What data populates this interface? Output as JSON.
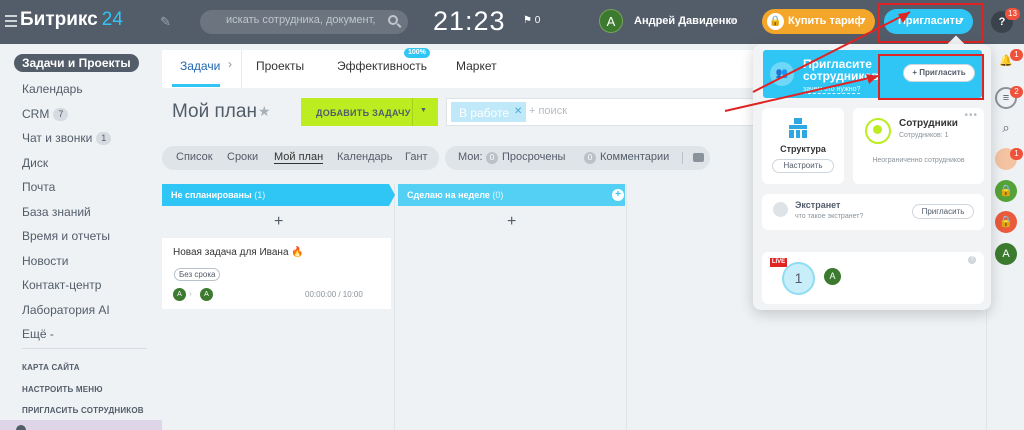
{
  "header": {
    "logo_text": "Битрикс",
    "logo_num": "24",
    "search_placeholder": "искать сотрудника, документ, проч...",
    "clock": "21:23",
    "flag_count": "0",
    "user_initial": "A",
    "user_name": "Андрей Давиденко",
    "buy_label": "Купить тариф",
    "invite_label": "Пригласить",
    "help_badge": "13"
  },
  "sidebar": {
    "active": "Задачи и Проекты",
    "items": [
      {
        "label": "Календарь",
        "count": ""
      },
      {
        "label": "CRM",
        "count": "7"
      },
      {
        "label": "Чат и звонки",
        "count": "1"
      },
      {
        "label": "Диск",
        "count": ""
      },
      {
        "label": "Почта",
        "count": ""
      },
      {
        "label": "База знаний",
        "count": ""
      },
      {
        "label": "Время и отчеты",
        "count": ""
      },
      {
        "label": "Новости",
        "count": ""
      },
      {
        "label": "Контакт-центр",
        "count": ""
      },
      {
        "label": "Лаборатория AI",
        "count": ""
      },
      {
        "label": "Ещё -",
        "count": ""
      }
    ],
    "captions": [
      "КАРТА САЙТА",
      "НАСТРОИТЬ МЕНЮ",
      "ПРИГЛАСИТЬ СОТРУДНИКОВ"
    ]
  },
  "tabs": {
    "items": [
      "Задачи",
      "Проекты",
      "Эффективность",
      "Маркет"
    ],
    "efficiency_badge": "100%"
  },
  "toolbar": {
    "title": "Мой план",
    "add_task": "ДОБАВИТЬ ЗАДАЧУ",
    "filter_chip": "В работе",
    "filter_placeholder": "+ поиск"
  },
  "views": {
    "items": [
      "Список",
      "Сроки",
      "Мой план",
      "Календарь",
      "Гант"
    ],
    "active": "Мой план",
    "mine_label": "Мои:",
    "overdue_count": "0",
    "overdue_label": "Просрочены",
    "comments_count": "0",
    "comments_label": "Комментарии"
  },
  "board": {
    "columns": [
      {
        "title": "Не спланированы",
        "count": "(1)",
        "color": "#2fc6f6"
      },
      {
        "title": "Сделаю на неделе",
        "count": "(0)",
        "color": "#55d0f5"
      }
    ],
    "plus": "+",
    "task": {
      "title": "Новая задача для Ивана",
      "deadline": "Без срока",
      "creator_initial": "A",
      "responsible_initial": "A",
      "time": "00:00:00 / 10:00"
    }
  },
  "popup": {
    "invite_title": "Пригласите сотрудников",
    "invite_subtitle": "зачем это нужно?",
    "invite_button": "+ Пригласить",
    "structure_title": "Структура",
    "structure_button": "Настроить",
    "employees_title": "Сотрудники",
    "employees_count": "Сотрудников: 1",
    "employees_unlimited": "Неограниченно сотрудников",
    "extranet_title": "Экстранет",
    "extranet_subtitle": "что такое экстранет?",
    "extranet_button": "Пригласить",
    "live_label": "LIVE",
    "online_count": "1",
    "online_initial": "A"
  },
  "rail": {
    "badges": [
      "1",
      "2",
      "1"
    ],
    "last_initial": "A"
  },
  "colors": {
    "header_bg": "#535c69",
    "accent": "#2fc6f6",
    "add_task_green": "#bbed21",
    "buy_orange": "#f4a62a",
    "highlight_red": "#e02424"
  }
}
